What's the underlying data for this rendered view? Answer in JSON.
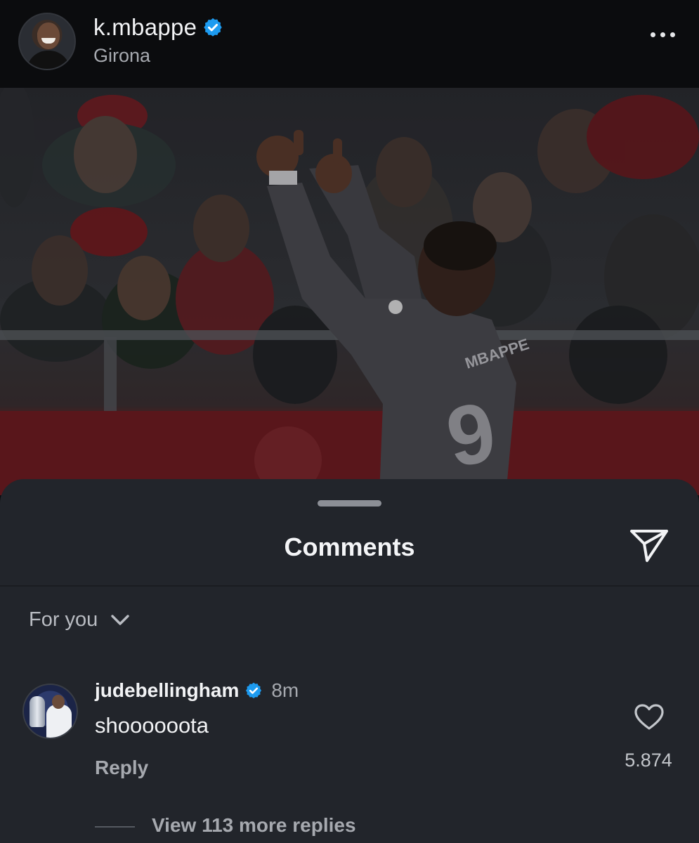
{
  "post": {
    "username": "k.mbappe",
    "location": "Girona",
    "verified_icon": "verified-badge-icon",
    "more_icon": "more-options-icon"
  },
  "photo": {
    "jersey_name": "MBAPPE",
    "jersey_number": "9"
  },
  "comments_sheet": {
    "title": "Comments",
    "share_icon": "send-icon",
    "sort_label": "For you",
    "sort_icon": "chevron-down-icon",
    "comments": [
      {
        "username": "judebellingham",
        "time": "8m",
        "text": "shoooooota",
        "reply_label": "Reply",
        "like_count": "5.874",
        "view_replies": "View 113 more replies"
      }
    ]
  },
  "colors": {
    "verified": "#1d9bf0",
    "sheet_bg": "#22252b",
    "header_bg": "#0b0c0e"
  }
}
